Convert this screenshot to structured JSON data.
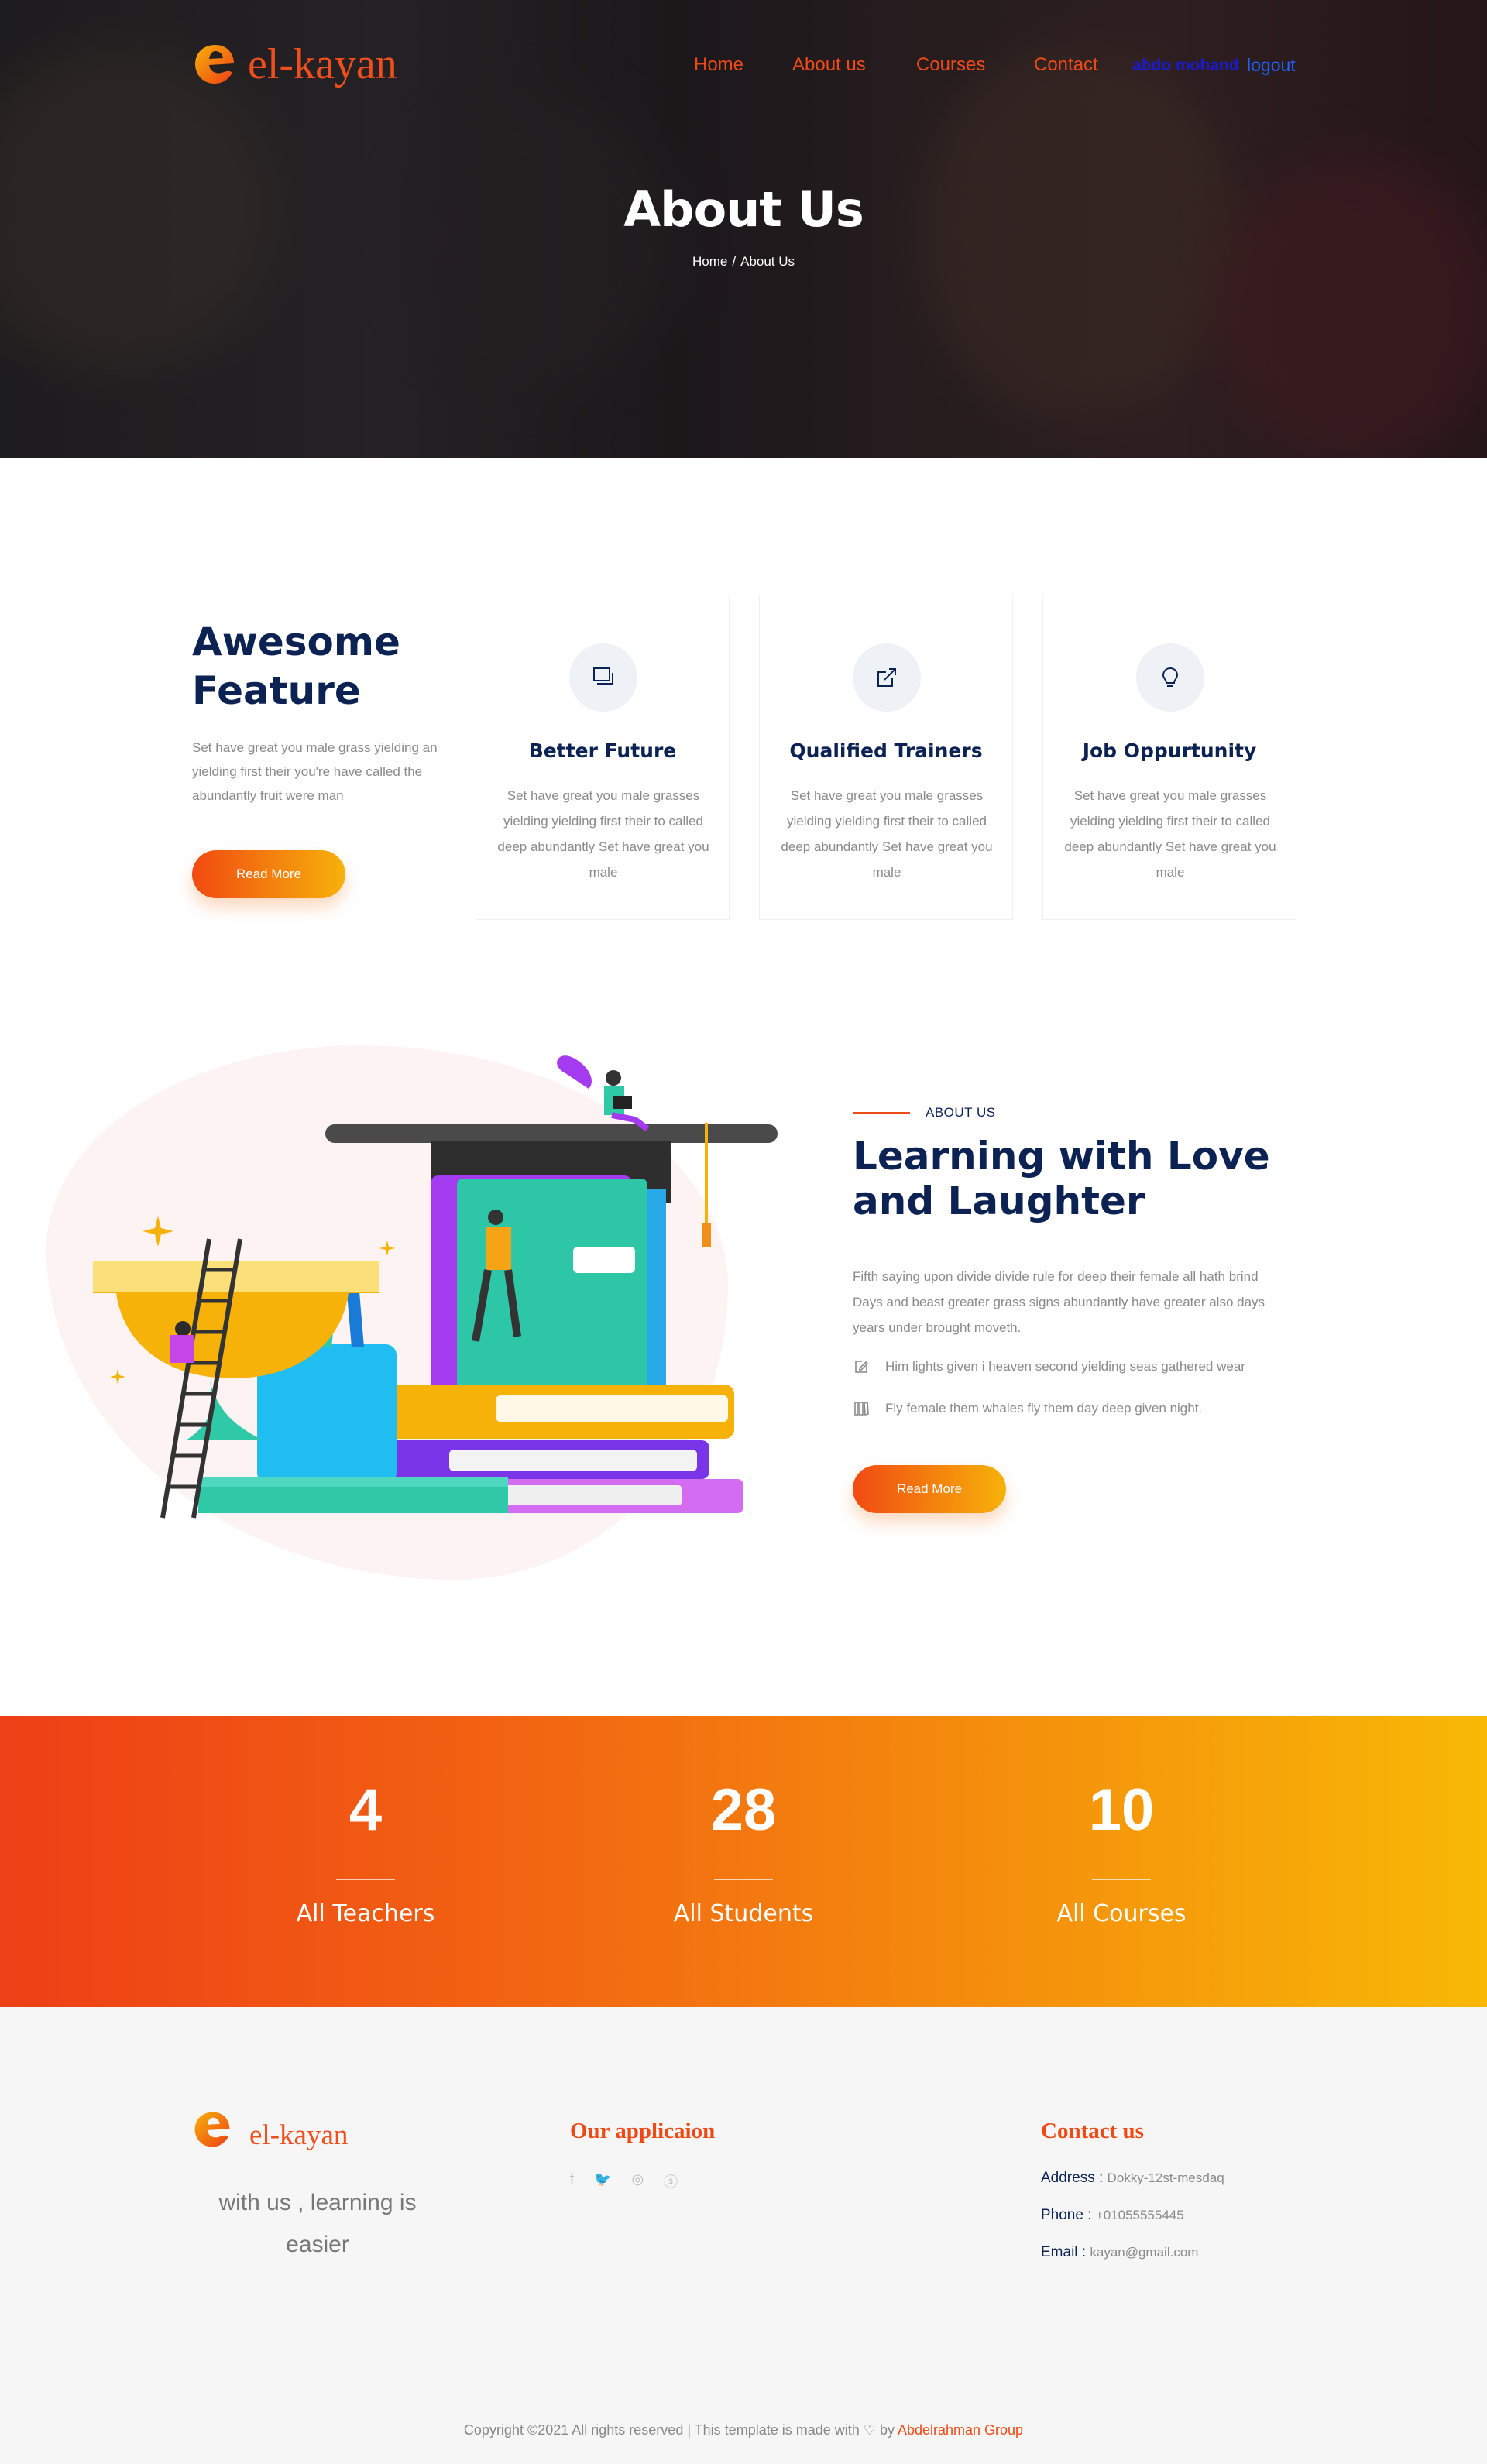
{
  "brand": {
    "name": "el-kayan",
    "color": "#ef4f1d"
  },
  "nav": {
    "items": [
      "Home",
      "About us",
      "Courses",
      "Contact"
    ],
    "user": "abdo mohand",
    "logout": "logout"
  },
  "hero": {
    "title": "About Us",
    "breadcrumb": {
      "home": "Home",
      "sep": "/",
      "current": "About Us"
    }
  },
  "features": {
    "heading": "Awesome Feature",
    "description": "Set have great you male grass yielding an yielding first their you're have called the abundantly fruit were man",
    "button": "Read More",
    "cards": [
      {
        "icon": "book-icon",
        "title": "Better Future",
        "text": "Set have great you male grasses yielding yielding first their to called deep abundantly Set have great you male"
      },
      {
        "icon": "external-link-icon",
        "title": "Qualified Trainers",
        "text": "Set have great you male grasses yielding yielding first their to called deep abundantly Set have great you male"
      },
      {
        "icon": "lightbulb-icon",
        "title": "Job Oppurtunity",
        "text": "Set have great you male grasses yielding yielding first their to called deep abundantly Set have great you male"
      }
    ]
  },
  "about": {
    "kicker": "ABOUT US",
    "heading": "Learning with Love and Laughter",
    "description": "Fifth saying upon divide divide rule for deep their female all hath brind Days and beast greater grass signs abundantly have greater also days years under brought moveth.",
    "items": [
      {
        "icon": "edit-icon",
        "text": "Him lights given i heaven second yielding seas gathered wear"
      },
      {
        "icon": "books-icon",
        "text": "Fly female them whales fly them day deep given night."
      }
    ],
    "button": "Read More"
  },
  "stats": [
    {
      "value": "4",
      "label": "All Teachers"
    },
    {
      "value": "28",
      "label": "All Students"
    },
    {
      "value": "10",
      "label": "All Courses"
    }
  ],
  "footer": {
    "tagline": "with us , learning is easier",
    "app_title": "Our applicaion",
    "social": [
      "facebook-icon",
      "twitter-icon",
      "instagram-icon",
      "skype-icon"
    ],
    "contact_title": "Contact us",
    "contact": [
      {
        "label": "Address :",
        "value": "Dokky-12st-mesdaq"
      },
      {
        "label": "Phone :",
        "value": "+01055555445"
      },
      {
        "label": "Email :",
        "value": "kayan@gmail.com"
      }
    ],
    "copyright": "Copyright ©2021 All rights reserved | This template is made with",
    "by": "by",
    "brand_credit": "Abdelrahman Group"
  }
}
